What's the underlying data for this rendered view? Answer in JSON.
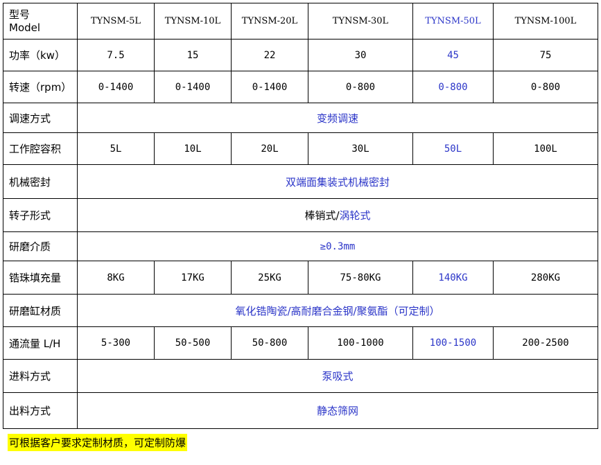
{
  "header": {
    "label_cn": "型号",
    "label_en": "Model",
    "models": [
      "TYNSM-5L",
      "TYNSM-10L",
      "TYNSM-20L",
      "TYNSM-30L",
      "TYNSM-50L",
      "TYNSM-100L"
    ]
  },
  "rows": {
    "power": {
      "label": "功率（kw）",
      "values": [
        "7.5",
        "15",
        "22",
        "30",
        "45",
        "75"
      ]
    },
    "speed": {
      "label": "转速（rpm）",
      "values": [
        "0-1400",
        "0-1400",
        "0-1400",
        "0-800",
        "0-800",
        "0-800"
      ]
    },
    "speed_control": {
      "label": "调速方式",
      "value": "变频调速"
    },
    "chamber_volume": {
      "label": "工作腔容积",
      "values": [
        "5L",
        "10L",
        "20L",
        "30L",
        "50L",
        "100L"
      ]
    },
    "mechanical_seal": {
      "label": "机械密封",
      "value": "双端面集装式机械密封"
    },
    "rotor_type": {
      "label": "转子形式",
      "value_a": "棒销式",
      "sep": "/",
      "value_b": "涡轮式"
    },
    "grinding_media": {
      "label": "研磨介质",
      "value": "≥0.3mm"
    },
    "bead_fill": {
      "label": "锆珠填充量",
      "values": [
        "8KG",
        "17KG",
        "25KG",
        "75-80KG",
        "140KG",
        "280KG"
      ]
    },
    "cylinder_material": {
      "label": "研磨缸材质",
      "value": "氧化锆陶瓷/高耐磨合金钢/聚氨酯（可定制）"
    },
    "flow_rate": {
      "label": "通流量 L/H",
      "values": [
        "5-300",
        "50-500",
        "50-800",
        "100-1000",
        "100-1500",
        "200-2500"
      ]
    },
    "feed_method": {
      "label": "进料方式",
      "value": "泵吸式"
    },
    "discharge_method": {
      "label": "出料方式",
      "value": "静态筛网"
    }
  },
  "note": "可根据客户要求定制材质，可定制防爆",
  "colors": {
    "highlight_text": "#2b35c8",
    "note_background": "#ffff00"
  }
}
